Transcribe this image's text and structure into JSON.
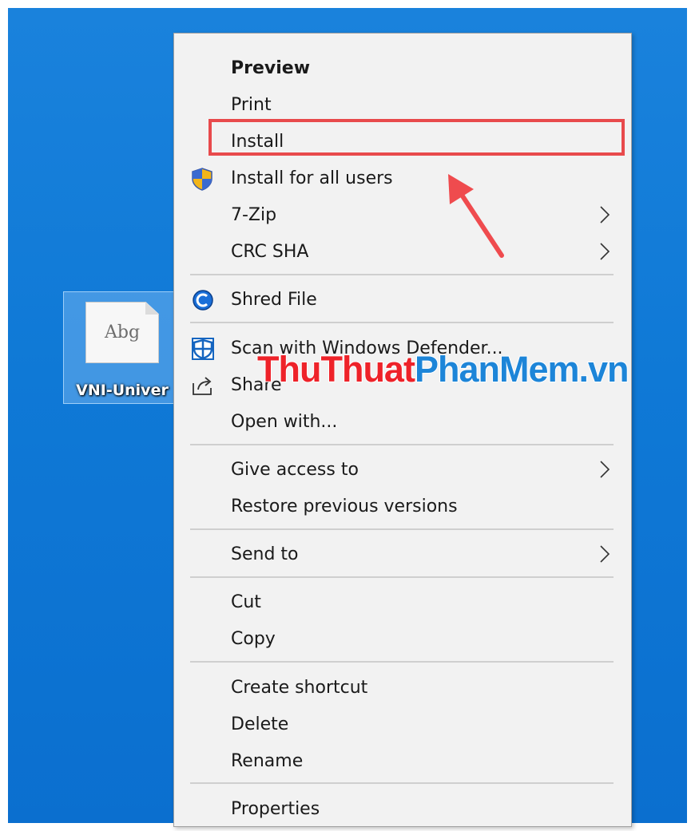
{
  "desktop_file": {
    "name": "VNI-Univer",
    "preview_glyph": "Abg"
  },
  "context_menu": {
    "items": [
      {
        "label": "Preview",
        "bold": true
      },
      {
        "label": "Print"
      },
      {
        "label": "Install",
        "highlighted": true
      },
      {
        "label": "Install for all users",
        "icon": "uac-shield-icon"
      },
      {
        "label": "7-Zip",
        "submenu": true
      },
      {
        "label": "CRC SHA",
        "submenu": true
      },
      {
        "label": "Shred File",
        "icon": "shred-file-icon"
      },
      {
        "label": "Scan with Windows Defender...",
        "icon": "windows-defender-icon"
      },
      {
        "label": "Share",
        "icon": "share-icon"
      },
      {
        "label": "Open with..."
      },
      {
        "label": "Give access to",
        "submenu": true
      },
      {
        "label": "Restore previous versions"
      },
      {
        "label": "Send to",
        "submenu": true
      },
      {
        "label": "Cut"
      },
      {
        "label": "Copy"
      },
      {
        "label": "Create shortcut"
      },
      {
        "label": "Delete"
      },
      {
        "label": "Rename"
      },
      {
        "label": "Properties"
      }
    ]
  },
  "annotation": {
    "highlight_color": "#e84a4c",
    "arrow_color": "#ef4b4e"
  },
  "watermark": {
    "part1": "ThuThuat",
    "part2": "PhanMem",
    "part3": ".vn"
  }
}
